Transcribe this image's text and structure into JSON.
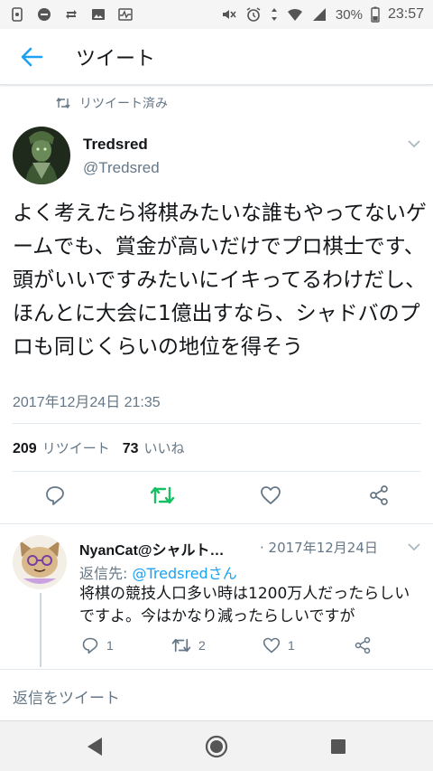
{
  "status_bar": {
    "battery_percent": "30%",
    "time": "23:57",
    "left_icons": [
      "sim-icon",
      "dnd-icon",
      "sync-icon",
      "image-icon",
      "pulse-icon"
    ],
    "right_icons": [
      "mute-icon",
      "alarm-icon",
      "data-arrows-icon",
      "wifi-icon",
      "signal-icon",
      "battery-icon"
    ]
  },
  "header": {
    "title": "ツイート"
  },
  "retweet_indicator": {
    "label": "リツイート済み"
  },
  "tweet": {
    "author_name": "Tredsred",
    "author_handle": "@Tredsred",
    "text": "よく考えたら将棋みたいな誰もやってないゲームでも、賞金が高いだけでプロ棋士です、頭がいいですみたいにイキってるわけだし、ほんとに大会に1億出すなら、シャドバのプロも同じくらいの地位を得そう",
    "timestamp": "2017年12月24日 21:35",
    "retweet_count": "209",
    "retweet_label": "リツイート",
    "like_count": "73",
    "like_label": "いいね"
  },
  "reply": {
    "author_name": "NyanCat@シャルト…",
    "date": "· 2017年12月24日",
    "reply_to_prefix": "返信先: ",
    "reply_to_mention": "@Tredsredさん",
    "text": "将棋の競技人口多い時は1200万人だったらしいですよ。今はかなり減ったらしいですが",
    "reply_count": "1",
    "retweet_count": "2",
    "like_count": "1"
  },
  "compose": {
    "placeholder": "返信をツイート"
  },
  "colors": {
    "accent": "#1da1f2",
    "retweet_green": "#17bf63",
    "secondary_text": "#657786",
    "divider": "#e1e8ed"
  }
}
